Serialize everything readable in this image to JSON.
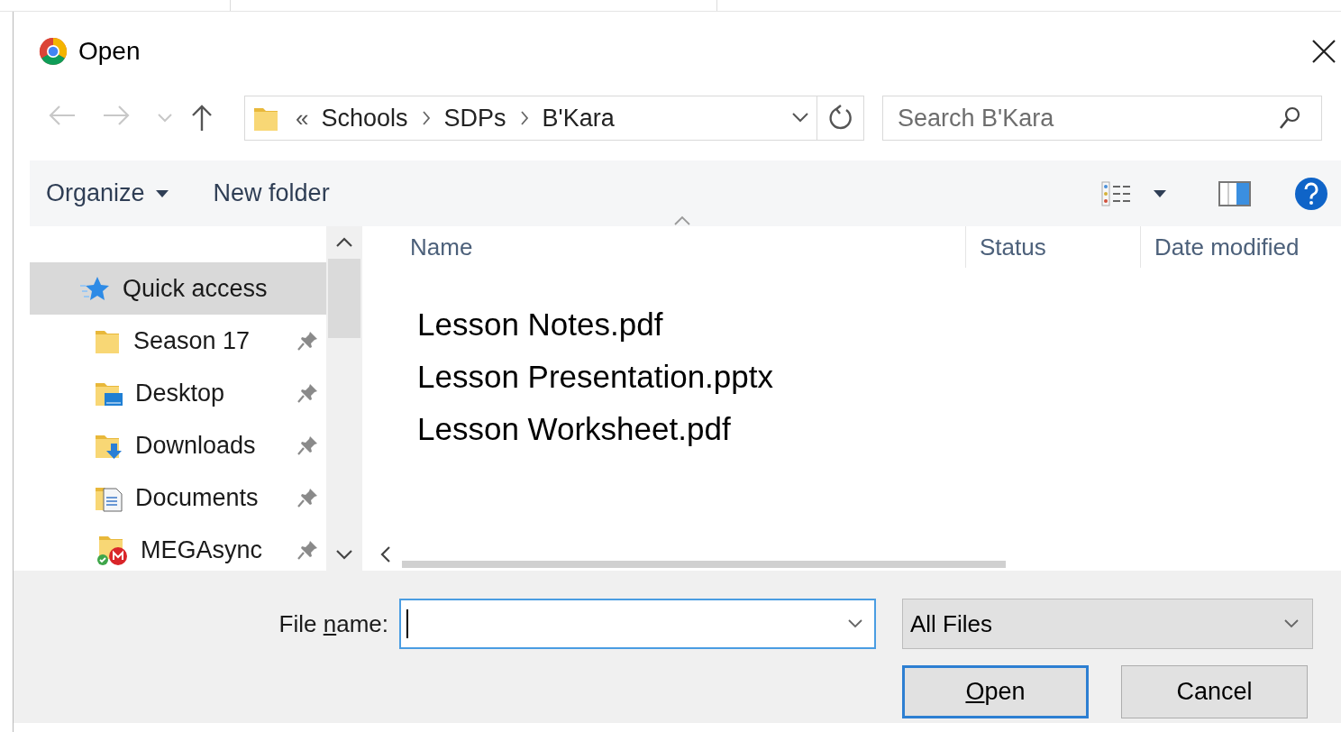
{
  "window": {
    "title": "Open"
  },
  "nav_buttons": [
    {
      "kind": "back",
      "disabled": true
    },
    {
      "kind": "forward",
      "disabled": true
    },
    {
      "kind": "recent",
      "disabled": true
    },
    {
      "kind": "up",
      "disabled": false
    }
  ],
  "address": {
    "overflow": "«",
    "path": [
      "Schools",
      "SDPs",
      "B'Kara"
    ]
  },
  "search": {
    "placeholder": "Search B'Kara"
  },
  "toolbar": {
    "buttons": [
      {
        "label": "Organize",
        "kind": "menu"
      },
      {
        "label": "New folder",
        "kind": "button"
      }
    ]
  },
  "sidebar": {
    "items": [
      {
        "label": "Quick access",
        "kind": "quick-access",
        "selected": true,
        "pinned": false
      },
      {
        "label": "Season 17",
        "kind": "folder",
        "selected": false,
        "pinned": true
      },
      {
        "label": "Desktop",
        "kind": "desktop",
        "selected": false,
        "pinned": true
      },
      {
        "label": "Downloads",
        "kind": "downloads",
        "selected": false,
        "pinned": true
      },
      {
        "label": "Documents",
        "kind": "documents",
        "selected": false,
        "pinned": true
      },
      {
        "label": "MEGAsync",
        "kind": "sync",
        "selected": false,
        "pinned": true
      }
    ]
  },
  "columns": [
    {
      "label": "Name",
      "sorted": true
    },
    {
      "label": "Status",
      "sorted": false
    },
    {
      "label": "Date modified",
      "sorted": false
    }
  ],
  "files": [
    "Lesson Notes.pdf",
    "Lesson Presentation.pptx",
    "Lesson Worksheet.pdf"
  ],
  "footer": {
    "file_name_label": [
      {
        "text": "File ",
        "underlined": false
      },
      {
        "text": "n",
        "underlined": true
      },
      {
        "text": "ame:",
        "underlined": false
      }
    ],
    "file_name_field": {
      "focused": true
    },
    "filter": {
      "value": "All Files"
    },
    "buttons": [
      {
        "label": [
          {
            "text": "O",
            "underlined": true
          },
          {
            "text": "pen",
            "underlined": false
          }
        ],
        "default": true
      },
      {
        "label": [
          {
            "text": "Cancel",
            "underlined": false
          }
        ],
        "default": false
      }
    ]
  }
}
